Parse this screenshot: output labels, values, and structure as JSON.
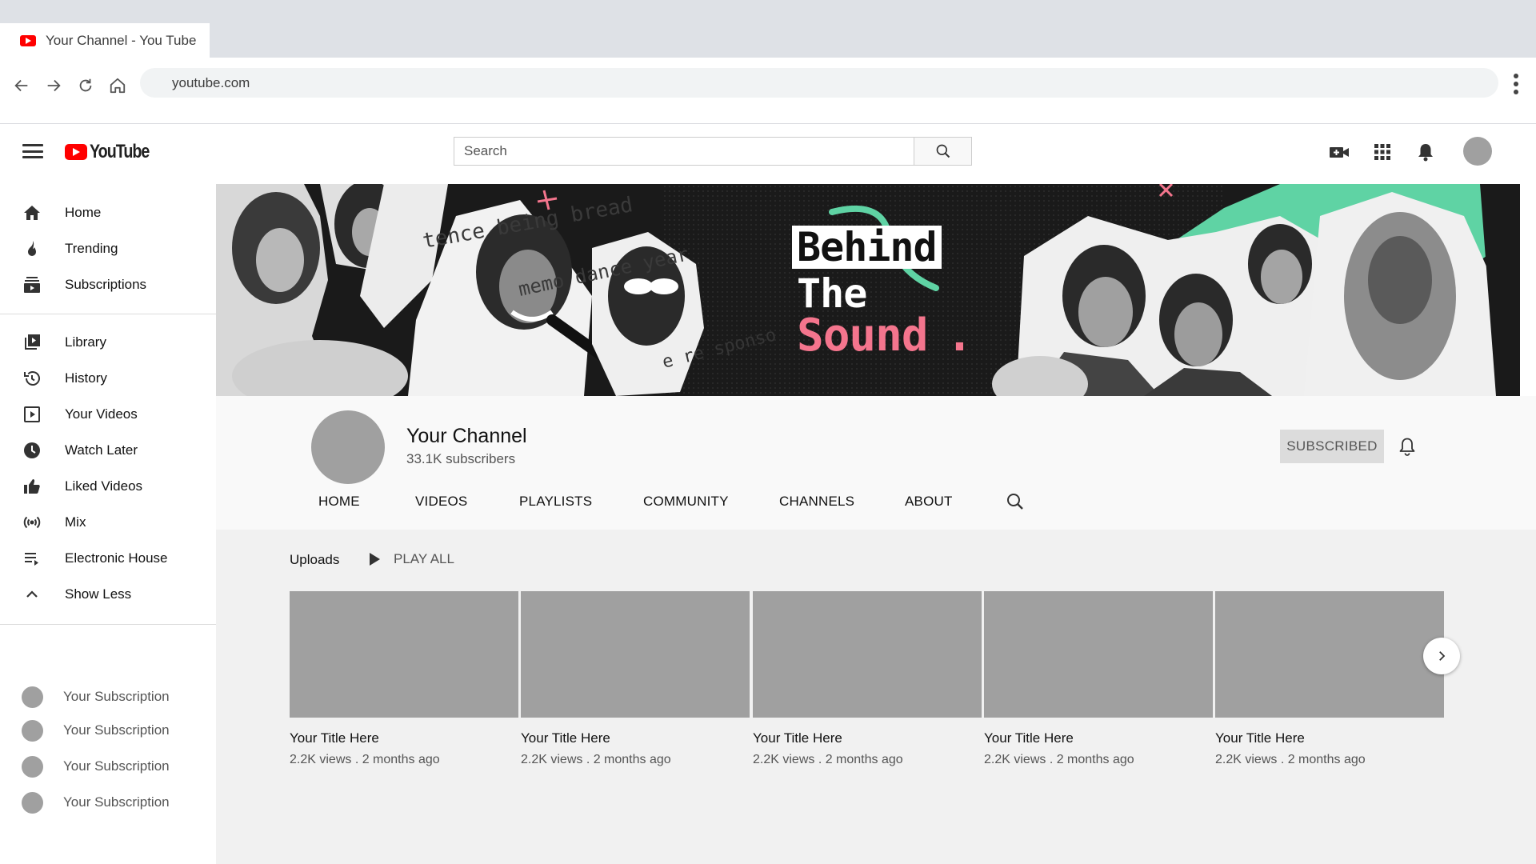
{
  "browser": {
    "tab_title": "Your Channel - You Tube",
    "url": "youtube.com"
  },
  "header": {
    "logo_text": "YouTube",
    "search_placeholder": "Search",
    "icons": [
      "create-video-icon",
      "apps-grid-icon",
      "notifications-bell-icon"
    ]
  },
  "sidebar": {
    "main": [
      {
        "label": "Home",
        "icon": "home-icon"
      },
      {
        "label": "Trending",
        "icon": "flame-icon"
      },
      {
        "label": "Subscriptions",
        "icon": "subscriptions-icon"
      }
    ],
    "library": [
      {
        "label": "Library",
        "icon": "library-icon"
      },
      {
        "label": "History",
        "icon": "history-icon"
      },
      {
        "label": "Your Videos",
        "icon": "your-videos-icon"
      },
      {
        "label": "Watch Later",
        "icon": "clock-icon"
      },
      {
        "label": "Liked Videos",
        "icon": "thumbs-up-icon"
      },
      {
        "label": "Mix",
        "icon": "broadcast-icon"
      },
      {
        "label": "Electronic House",
        "icon": "playlist-icon"
      },
      {
        "label": "Show Less",
        "icon": "chevron-up-icon"
      }
    ],
    "subscriptions": [
      {
        "label": "Your Subscription"
      },
      {
        "label": "Your Subscription"
      },
      {
        "label": "Your Subscription"
      },
      {
        "label": "Your Subscription"
      }
    ]
  },
  "banner": {
    "line1": "Behind",
    "line2": "The",
    "line3": "Sound",
    "line3_dot": ".",
    "colors": {
      "pink": "#f4758d",
      "mint": "#5fd3a4"
    }
  },
  "channel": {
    "name": "Your Channel",
    "subscribers": "33.1K subscribers",
    "subscribed_label": "SUBSCRIBED",
    "tabs": [
      "HOME",
      "VIDEOS",
      "PLAYLISTS",
      "COMMUNITY",
      "CHANNELS",
      "ABOUT"
    ]
  },
  "uploads": {
    "label": "Uploads",
    "play_all": "PLAY ALL",
    "videos": [
      {
        "title": "Your Title Here",
        "meta": "2.2K views . 2 months ago"
      },
      {
        "title": "Your Title Here",
        "meta": "2.2K views . 2 months ago"
      },
      {
        "title": "Your Title Here",
        "meta": "2.2K views . 2 months ago"
      },
      {
        "title": "Your Title Here",
        "meta": "2.2K views . 2 months ago"
      },
      {
        "title": "Your Title Here",
        "meta": "2.2K views . 2 months ago"
      }
    ]
  }
}
